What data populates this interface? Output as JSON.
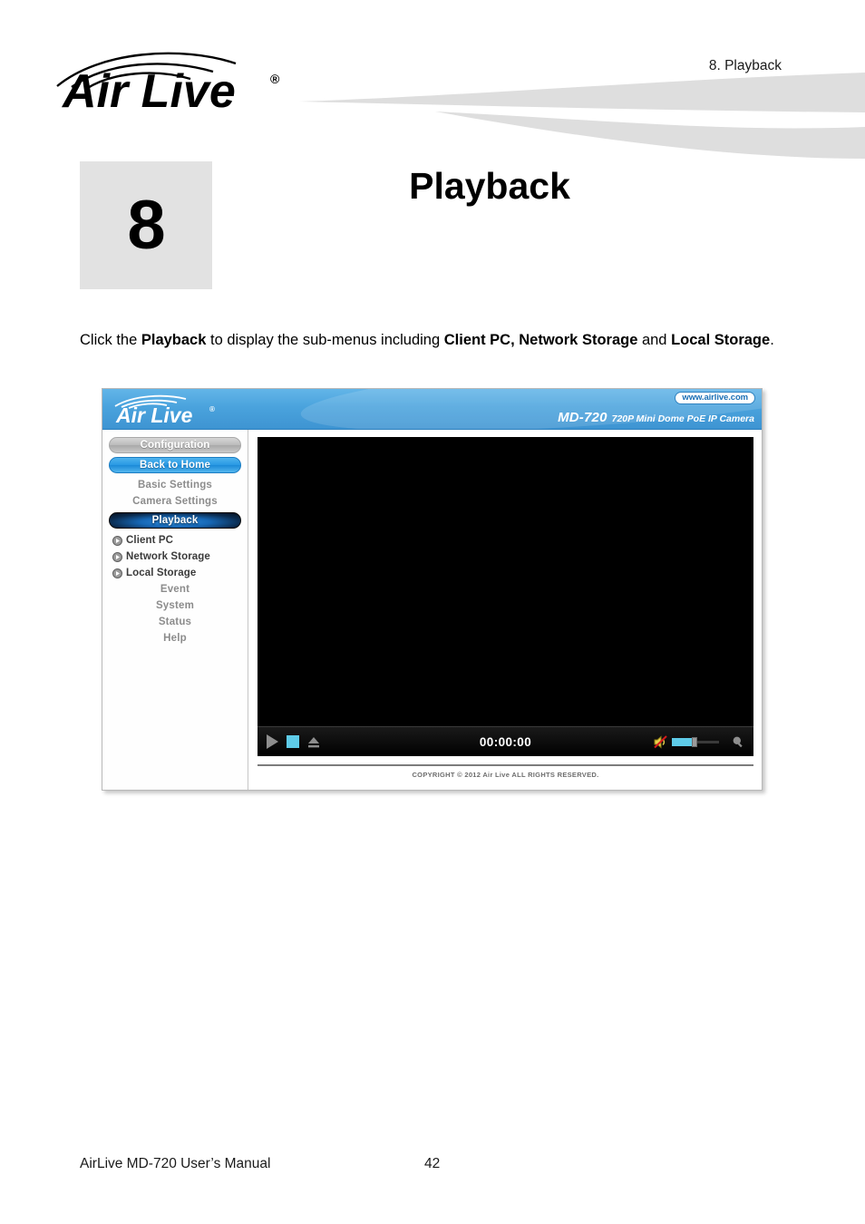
{
  "page": {
    "running_header": "8.  Playback",
    "chapter_number": "8",
    "chapter_title": "Playback",
    "footer_manual": "AirLive MD-720 User’s Manual",
    "footer_page_number": "42",
    "brand_logo_text": "Air Live",
    "brand_logo_trademark": "®"
  },
  "intro": {
    "part1": "Click the ",
    "bold1": "Playback",
    "part2": " to display the sub-menus including ",
    "bold2": "Client PC, Network Storage",
    "part3": " and ",
    "bold3": "Local Storage",
    "part4": "."
  },
  "camera_ui": {
    "brand_text": "Air Live",
    "site_url": "www.airlive.com",
    "model": "MD-720",
    "model_description": "720P Mini Dome PoE IP Camera",
    "sidebar": [
      {
        "label": "Configuration",
        "style": "gray-button",
        "icon": "none"
      },
      {
        "label": "Back to Home",
        "style": "blue-button",
        "icon": "none"
      },
      {
        "label": "Basic Settings",
        "style": "plain",
        "icon": "none"
      },
      {
        "label": "Camera Settings",
        "style": "plain",
        "icon": "none"
      },
      {
        "label": "Playback",
        "style": "dark-button",
        "icon": "none"
      },
      {
        "label": "Client PC",
        "style": "sub",
        "icon": "play-circle-icon"
      },
      {
        "label": "Network Storage",
        "style": "sub",
        "icon": "play-circle-icon"
      },
      {
        "label": "Local Storage",
        "style": "sub",
        "icon": "play-circle-icon"
      },
      {
        "label": "Event",
        "style": "plain",
        "icon": "none"
      },
      {
        "label": "System",
        "style": "plain",
        "icon": "none"
      },
      {
        "label": "Status",
        "style": "plain",
        "icon": "none"
      },
      {
        "label": "Help",
        "style": "plain",
        "icon": "none"
      }
    ],
    "player": {
      "play_icon": "play-icon",
      "stop_icon": "stop-icon",
      "eject_icon": "eject-icon",
      "time": "00:00:00",
      "mute_icon": "speaker-muted-icon",
      "zoom_icon": "magnifier-icon",
      "volume_percent": 42
    },
    "footer_copyright": "COPYRIGHT © 2012 Air Live ALL RIGHTS RESERVED."
  },
  "colors": {
    "ui_header_blue": "#4aa3dd",
    "accent_cyan": "#5ecbe8",
    "chapter_badge_gray": "#e2e2e2",
    "swoosh_gray": "#dcdcdc"
  }
}
